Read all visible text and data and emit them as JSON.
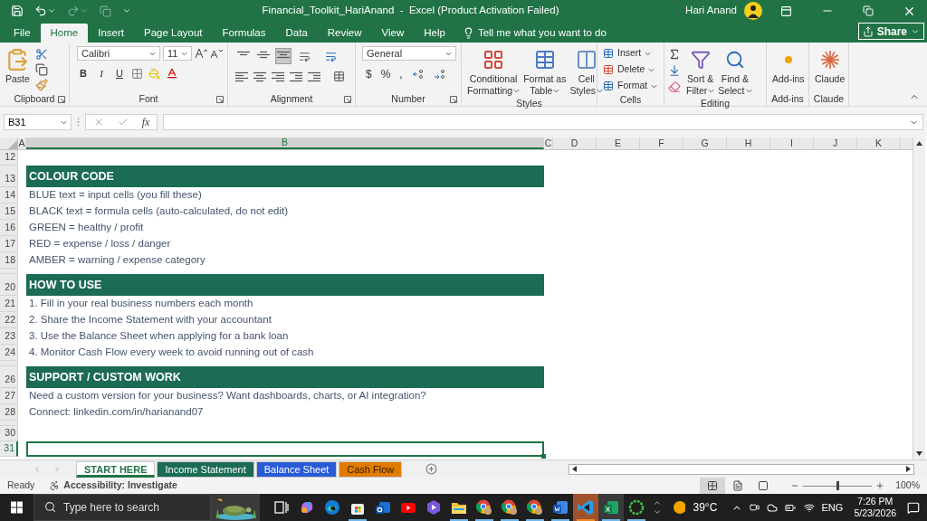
{
  "window": {
    "title": "Financial_Toolkit_HariAnand  -  Excel (Product Activation Failed)",
    "user": "Hari Anand"
  },
  "menu_tabs": [
    {
      "label": "File",
      "selected": false
    },
    {
      "label": "Home",
      "selected": true
    },
    {
      "label": "Insert",
      "selected": false
    },
    {
      "label": "Page Layout",
      "selected": false
    },
    {
      "label": "Formulas",
      "selected": false
    },
    {
      "label": "Data",
      "selected": false
    },
    {
      "label": "Review",
      "selected": false
    },
    {
      "label": "View",
      "selected": false
    },
    {
      "label": "Help",
      "selected": false
    }
  ],
  "tell_me": {
    "placeholder": "Tell me what you want to do"
  },
  "share": "Share",
  "ribbon": {
    "clipboard": {
      "label": "Clipboard",
      "paste": "Paste"
    },
    "font": {
      "label": "Font",
      "font_name": "Calibri",
      "font_size": "11",
      "styles": [
        "B",
        "I",
        "U"
      ]
    },
    "alignment": {
      "label": "Alignment",
      "vertical": [
        {
          "selected": false
        },
        {
          "selected": false
        },
        {
          "selected": true
        }
      ]
    },
    "number": {
      "label": "Number",
      "format": "General",
      "symbols": [
        "$",
        "%",
        ","
      ]
    },
    "styles": {
      "label": "Styles",
      "buttons": [
        {
          "lines": [
            "Conditional",
            "Formatting"
          ]
        },
        {
          "lines": [
            "Format as",
            "Table"
          ]
        },
        {
          "lines": [
            "Cell",
            "Styles"
          ]
        }
      ]
    },
    "cells": {
      "label": "Cells",
      "buttons": [
        "Insert",
        "Delete",
        "Format"
      ]
    },
    "editing": {
      "label": "Editing",
      "buttons": [
        {
          "lines": [
            "Sort &",
            "Filter"
          ]
        },
        {
          "lines": [
            "Find &",
            "Select"
          ]
        }
      ]
    },
    "addins": {
      "label": "Add-ins",
      "button": "Add-ins"
    },
    "claude": {
      "label": "Claude",
      "button": "Claude"
    }
  },
  "formula_bar": {
    "name_box": "B31",
    "fx": "fx"
  },
  "columns": [
    {
      "label": "A",
      "selected": false
    },
    {
      "label": "B",
      "selected": true
    },
    {
      "label": "C",
      "selected": false
    },
    {
      "label": "D",
      "selected": false
    },
    {
      "label": "E",
      "selected": false
    },
    {
      "label": "F",
      "selected": false
    },
    {
      "label": "G",
      "selected": false
    },
    {
      "label": "H",
      "selected": false
    },
    {
      "label": "I",
      "selected": false
    },
    {
      "label": "J",
      "selected": false
    },
    {
      "label": "K",
      "selected": false
    }
  ],
  "rows": [
    {
      "number": "12",
      "kind": "blank",
      "selected": false
    },
    {
      "number": "13",
      "kind": "banner",
      "text": "COLOUR CODE",
      "selected": false
    },
    {
      "number": "14",
      "kind": "text",
      "text": "BLUE text = input cells (you fill these)",
      "selected": false
    },
    {
      "number": "15",
      "kind": "text",
      "text": "BLACK text = formula cells (auto-calculated, do not edit)",
      "selected": false
    },
    {
      "number": "16",
      "kind": "text",
      "text": "GREEN = healthy / profit",
      "selected": false
    },
    {
      "number": "17",
      "kind": "text",
      "text": "RED = expense / loss / danger",
      "selected": false
    },
    {
      "number": "18",
      "kind": "text",
      "text": "AMBER = warning / expense category",
      "selected": false
    },
    {
      "kind": "spacer",
      "selected": false
    },
    {
      "number": "20",
      "kind": "banner",
      "text": "HOW TO USE",
      "selected": false
    },
    {
      "number": "21",
      "kind": "text",
      "text": "1. Fill in your real business numbers each month",
      "selected": false
    },
    {
      "number": "22",
      "kind": "text",
      "text": "2. Share the Income Statement with your accountant",
      "selected": false
    },
    {
      "number": "23",
      "kind": "text",
      "text": "3. Use the Balance Sheet when applying for a bank loan",
      "selected": false
    },
    {
      "number": "24",
      "kind": "text",
      "text": "4. Monitor Cash Flow every week to avoid running out of cash",
      "selected": false
    },
    {
      "kind": "spacer",
      "selected": false
    },
    {
      "number": "26",
      "kind": "banner",
      "text": "SUPPORT / CUSTOM WORK",
      "selected": false
    },
    {
      "number": "27",
      "kind": "text",
      "text": "Need a custom version for your business? Want dashboards, charts, or AI integration?",
      "selected": false
    },
    {
      "number": "28",
      "kind": "text",
      "text": "Connect: linkedin.com/in/harianand07",
      "selected": false
    },
    {
      "kind": "spacer",
      "selected": false
    },
    {
      "number": "30",
      "kind": "blank",
      "selected": false
    },
    {
      "number": "31",
      "kind": "blank",
      "selected": true
    }
  ],
  "sheet_tabs": [
    {
      "label": "START HERE",
      "selected": true,
      "color": "#217346"
    },
    {
      "label": "Income Statement",
      "selected": false,
      "color": "#1b6b55"
    },
    {
      "label": "Balance Sheet",
      "selected": false,
      "color": "#2a5bd7"
    },
    {
      "label": "Cash Flow",
      "selected": false,
      "color": "#e07b00"
    }
  ],
  "status_bar": {
    "ready": "Ready",
    "accessibility": "Accessibility: Investigate",
    "views": [
      {
        "selected": true
      },
      {
        "selected": false
      },
      {
        "selected": false
      }
    ],
    "zoom": {
      "level": 0.5,
      "reading": "100%"
    }
  },
  "taskbar": {
    "search": {
      "placeholder": "Type here to search"
    },
    "apps": [
      {
        "kind": "taskview",
        "open": false,
        "attention": false,
        "focused": false
      },
      {
        "kind": "copilot",
        "open": false,
        "attention": false,
        "focused": false
      },
      {
        "kind": "edge",
        "open": false,
        "attention": false,
        "focused": false
      },
      {
        "kind": "store",
        "open": true,
        "attention": false,
        "focused": false
      },
      {
        "kind": "outlook",
        "open": false,
        "attention": false,
        "focused": false
      },
      {
        "kind": "youtube",
        "open": false,
        "attention": false,
        "focused": false
      },
      {
        "kind": "clipchamp",
        "open": false,
        "attention": false,
        "focused": false
      },
      {
        "kind": "explorer",
        "open": true,
        "attention": false,
        "focused": false
      },
      {
        "kind": "chrome",
        "open": true,
        "attention": false,
        "focused": false
      },
      {
        "kind": "chrome",
        "open": true,
        "attention": false,
        "focused": false
      },
      {
        "kind": "chrome",
        "open": true,
        "attention": false,
        "focused": false
      },
      {
        "kind": "word",
        "open": true,
        "attention": false,
        "focused": false
      },
      {
        "kind": "vscode",
        "open": true,
        "attention": true,
        "focused": false
      },
      {
        "kind": "excel",
        "open": true,
        "attention": false,
        "focused": true
      },
      {
        "kind": "ring",
        "open": true,
        "attention": false,
        "focused": false
      }
    ],
    "weather": "39°C",
    "language": "ENG",
    "time": "7:26 PM",
    "date": "5/23/2026"
  }
}
